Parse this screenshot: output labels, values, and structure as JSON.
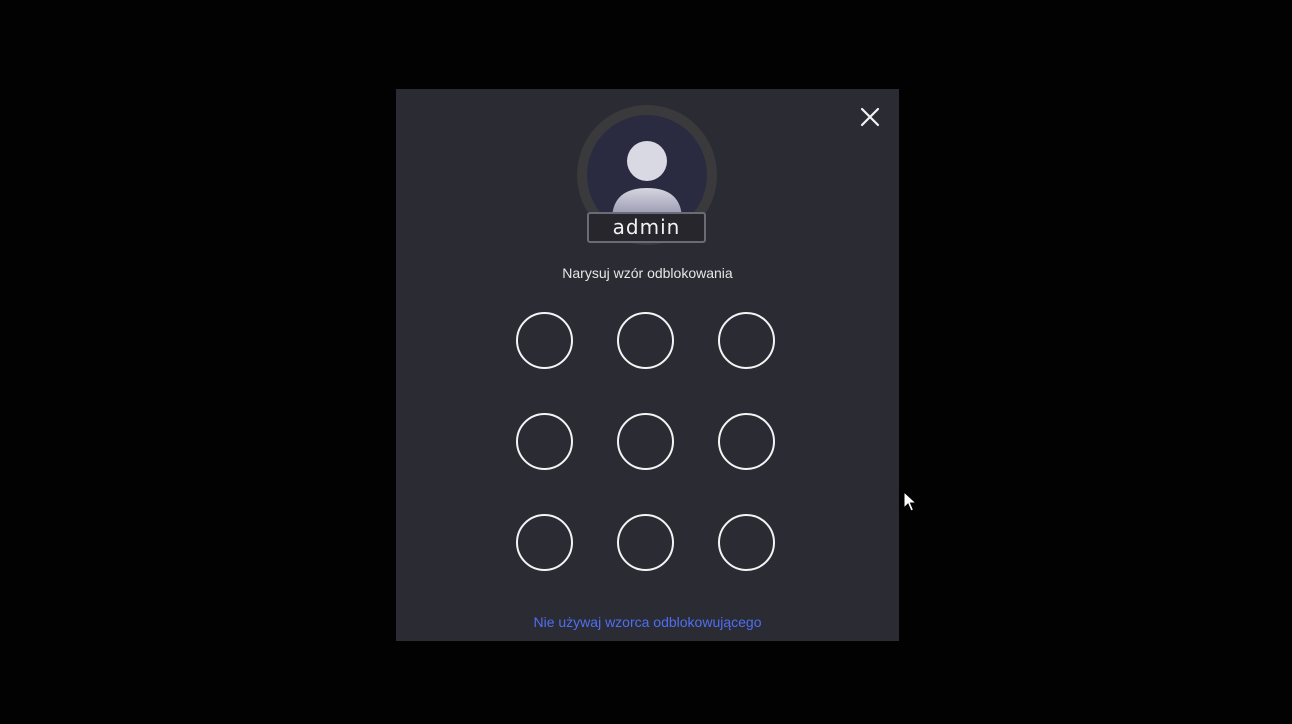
{
  "dialog": {
    "user": {
      "name": "admin"
    },
    "prompt": "Narysuj wzór odblokowania",
    "pattern_dots": 9,
    "alternative_link": "Nie używaj wzorca odblokowującego"
  },
  "icons": {
    "close": "close-icon",
    "avatar": "user-avatar-icon",
    "cursor": "mouse-pointer-icon"
  },
  "colors": {
    "background": "#020202",
    "dialog": "#2b2b33",
    "link": "#4f6ff2",
    "dot_stroke": "#f4f4f4"
  }
}
